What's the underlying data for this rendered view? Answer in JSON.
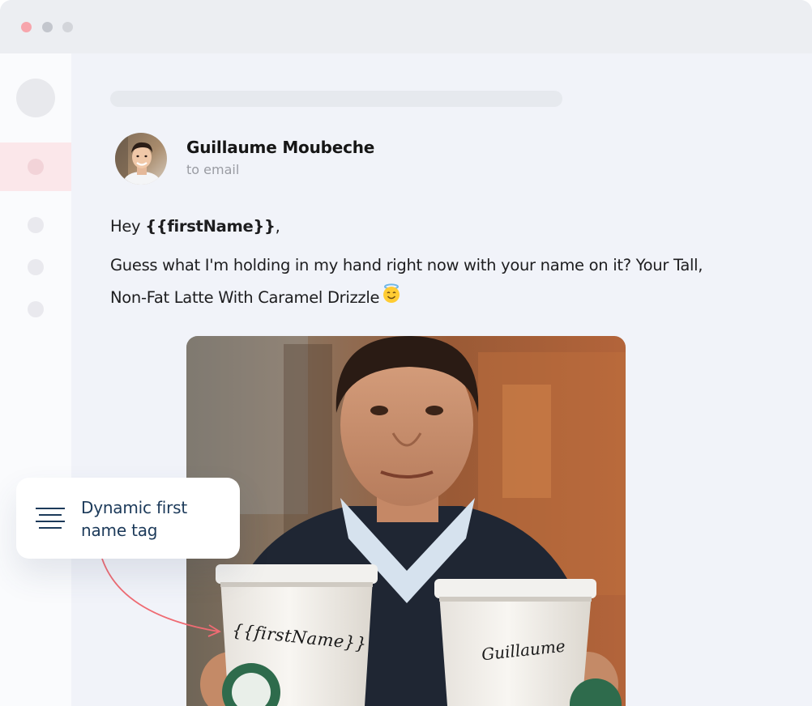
{
  "window": {
    "traffic_lights": [
      {
        "name": "close",
        "color": "#f7a5ac"
      },
      {
        "name": "minimize",
        "color": "#c3c6cd"
      },
      {
        "name": "zoom",
        "color": "#d3d5da"
      }
    ]
  },
  "sidebar": {
    "accent_color": "#fbe7ea"
  },
  "email": {
    "sender_name": "Guillaume Moubeche",
    "recipient": "to email",
    "greeting_prefix": "Hey ",
    "greeting_tag": "{{firstName}}",
    "greeting_suffix": ",",
    "body_line_1": "Guess what I'm holding in my hand right now with your name on it? Your Tall,",
    "body_line_2": "Non-Fat Latte With Caramel Drizzle",
    "emoji_icon": "smiling-face-with-halo-icon",
    "cup_left_label": "{{firstName}}",
    "cup_right_label": "Guillaume"
  },
  "tooltip": {
    "icon": "text-lines-icon",
    "line_1": "Dynamic first",
    "line_2": "name tag",
    "arrow_color": "#ef6b73"
  }
}
